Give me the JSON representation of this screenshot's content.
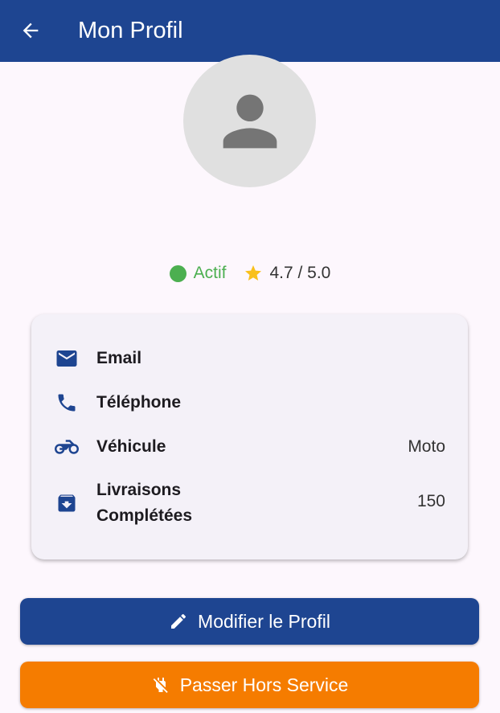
{
  "header": {
    "title": "Mon Profil",
    "back_icon": "arrow-back-icon"
  },
  "profile": {
    "avatar_icon": "person-icon",
    "status": {
      "label": "Actif",
      "color": "#4caf50"
    },
    "rating": {
      "value": "4.7 / 5.0",
      "icon": "star-icon",
      "color": "#f9c01c"
    }
  },
  "info": [
    {
      "icon": "email-icon",
      "label": "Email",
      "value": ""
    },
    {
      "icon": "phone-icon",
      "label": "Téléphone",
      "value": ""
    },
    {
      "icon": "motorcycle-icon",
      "label": "Véhicule",
      "value": "Moto"
    },
    {
      "icon": "delivery-box-icon",
      "label_line1": "Livraisons",
      "label_line2": "Complétées",
      "value": "150"
    }
  ],
  "actions": {
    "edit_label": "Modifier le Profil",
    "off_duty_label": "Passer Hors Service"
  },
  "colors": {
    "primary": "#1e4591",
    "accent": "#f57c00",
    "background": "#fdf7fd"
  }
}
